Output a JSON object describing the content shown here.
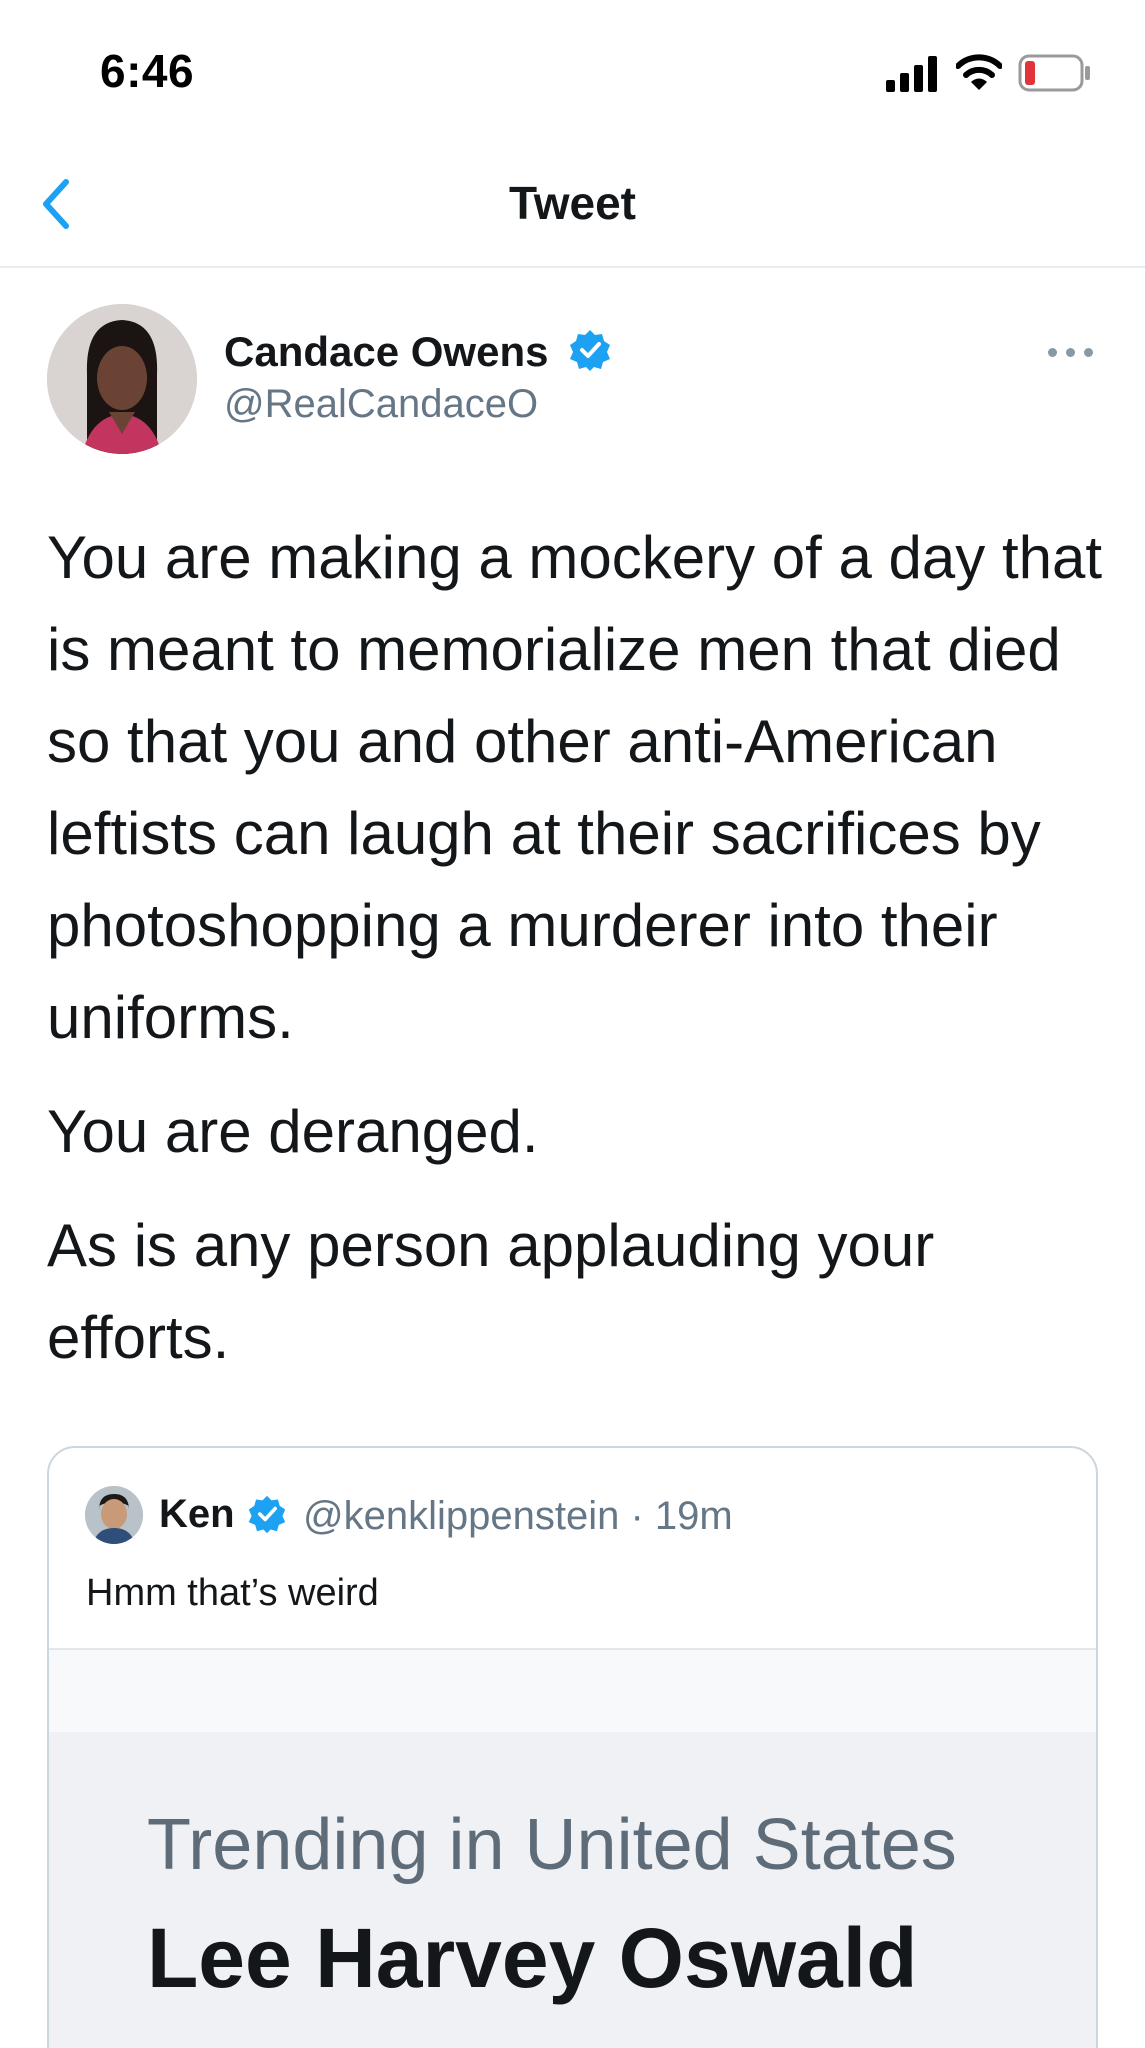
{
  "status_bar": {
    "time": "6:46"
  },
  "nav": {
    "title": "Tweet"
  },
  "tweet": {
    "author_name": "Candace Owens",
    "author_handle": "@RealCandaceO",
    "paragraphs": [
      "You are making a mockery of a day that is meant to memorialize men that died so that you and other anti-American leftists can laugh at their sacrifices by photoshopping a murderer into their uniforms.",
      "You are deranged.",
      "As is any person applauding your efforts."
    ]
  },
  "quoted_tweet": {
    "author_name": "Ken",
    "author_handle": "@kenklippenstein · 19m",
    "text": "Hmm that’s weird",
    "media": {
      "label": "Trending in United States",
      "topic": "Lee Harvey Oswald"
    }
  },
  "colors": {
    "accent": "#1da1f2",
    "text_primary": "#14171a",
    "text_secondary": "#657786",
    "border": "#ccd6dd",
    "battery_low": "#e0333a"
  },
  "icons": {
    "back": "chevron-left-icon",
    "verified": "verified-badge-icon",
    "more": "more-horizontal-icon",
    "signal": "cellular-signal-icon",
    "wifi": "wifi-icon",
    "battery": "battery-icon"
  }
}
